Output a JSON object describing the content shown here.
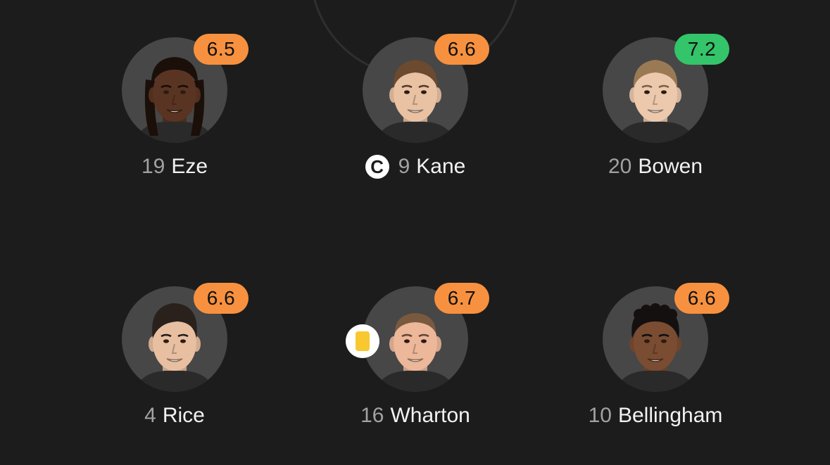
{
  "colors": {
    "background": "#1c1c1c",
    "avatar_bg": "#474747",
    "rating_orange": "#f7913f",
    "rating_green": "#34c46a",
    "yellow_card": "#f9c730"
  },
  "players": [
    {
      "number": "19",
      "name": "Eze",
      "rating": "6.5",
      "rating_color": "#f7913f",
      "captain": false,
      "captain_icon": "",
      "yellow_card": false,
      "skin": "#5a3422",
      "hair": "#1b0f0a",
      "hair_style": "locs"
    },
    {
      "number": "9",
      "name": "Kane",
      "rating": "6.6",
      "rating_color": "#f7913f",
      "captain": true,
      "captain_icon": "C",
      "yellow_card": false,
      "skin": "#e9c1a3",
      "hair": "#6b4a2f",
      "hair_style": "short"
    },
    {
      "number": "20",
      "name": "Bowen",
      "rating": "7.2",
      "rating_color": "#34c46a",
      "captain": false,
      "captain_icon": "",
      "yellow_card": false,
      "skin": "#ecc9ad",
      "hair": "#9a7a55",
      "hair_style": "short"
    },
    {
      "number": "4",
      "name": "Rice",
      "rating": "6.6",
      "rating_color": "#f7913f",
      "captain": false,
      "captain_icon": "",
      "yellow_card": false,
      "skin": "#e8bfa1",
      "hair": "#2a211c",
      "hair_style": "quiff"
    },
    {
      "number": "16",
      "name": "Wharton",
      "rating": "6.7",
      "rating_color": "#f7913f",
      "captain": false,
      "captain_icon": "",
      "yellow_card": true,
      "skin": "#edb79a",
      "hair": "#7a5a3f",
      "hair_style": "buzz"
    },
    {
      "number": "10",
      "name": "Bellingham",
      "rating": "6.6",
      "rating_color": "#f7913f",
      "captain": false,
      "captain_icon": "",
      "yellow_card": false,
      "skin": "#7a4c32",
      "hair": "#141010",
      "hair_style": "curly"
    }
  ]
}
